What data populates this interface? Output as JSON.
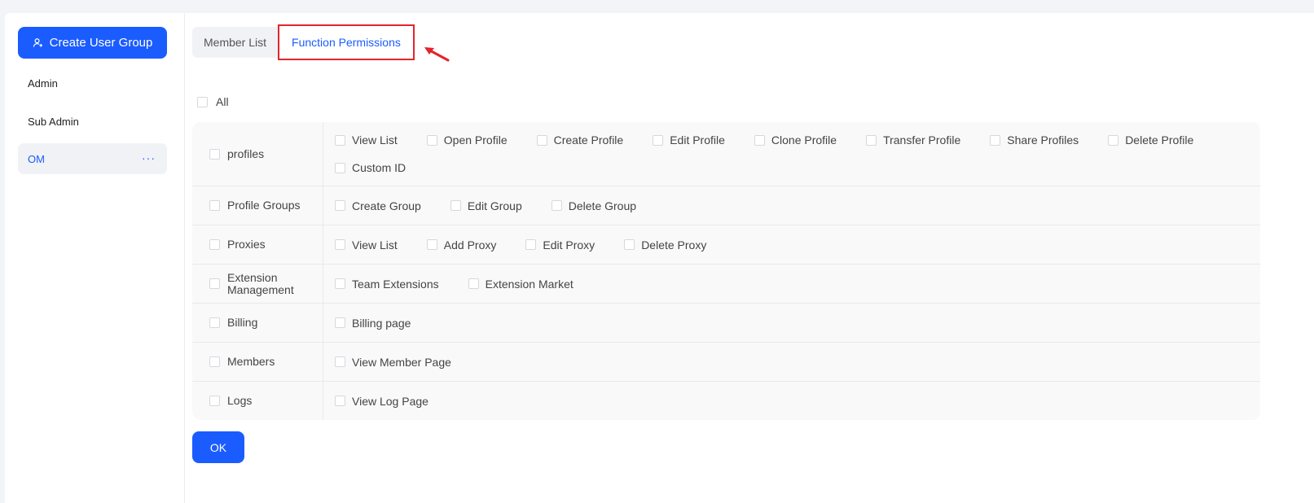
{
  "sidebar": {
    "create_label": "Create User Group",
    "groups": [
      {
        "label": "Admin",
        "active": false
      },
      {
        "label": "Sub Admin",
        "active": false
      },
      {
        "label": "OM",
        "active": true,
        "more": "···"
      }
    ]
  },
  "tabs": [
    {
      "label": "Member List",
      "active": false
    },
    {
      "label": "Function Permissions",
      "active": true
    }
  ],
  "all_label": "All",
  "permissions": [
    {
      "category": "profiles",
      "options": [
        "View List",
        "Open Profile",
        "Create Profile",
        "Edit Profile",
        "Clone Profile",
        "Transfer Profile",
        "Share Profiles",
        "Delete Profile",
        "Custom ID"
      ]
    },
    {
      "category": "Profile Groups",
      "options": [
        "Create Group",
        "Edit Group",
        "Delete Group"
      ]
    },
    {
      "category": "Proxies",
      "options": [
        "View List",
        "Add Proxy",
        "Edit Proxy",
        "Delete Proxy"
      ]
    },
    {
      "category": "Extension Management",
      "options": [
        "Team Extensions",
        "Extension Market"
      ]
    },
    {
      "category": "Billing",
      "options": [
        "Billing page"
      ]
    },
    {
      "category": "Members",
      "options": [
        "View Member Page"
      ]
    },
    {
      "category": "Logs",
      "options": [
        "View Log Page"
      ]
    }
  ],
  "ok_label": "OK",
  "colors": {
    "accent": "#1b5cff",
    "highlight": "#e3242b"
  },
  "icons": {
    "create": "user-add-icon",
    "arrow": "arrow-pointer-icon"
  }
}
